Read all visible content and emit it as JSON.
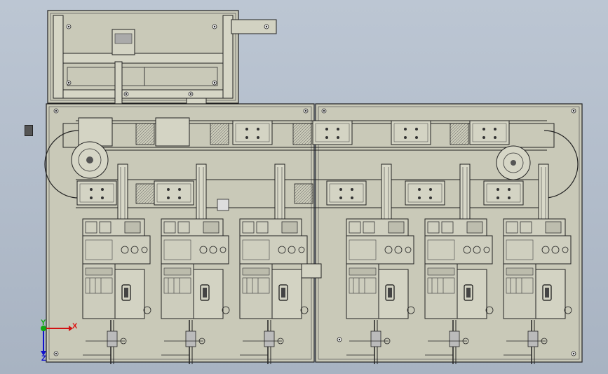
{
  "view": {
    "background_top": "#bcc6d3",
    "background_bottom": "#a8b3c2",
    "plate_color": "#c9c9b8",
    "line_color": "#2a2a2a"
  },
  "triad": {
    "x_label": "X",
    "y_label": "Y",
    "z_label": "Z",
    "x_color": "#d11111",
    "y_color": "#11a811",
    "z_color": "#1111cc"
  },
  "stations": {
    "count": 6
  }
}
